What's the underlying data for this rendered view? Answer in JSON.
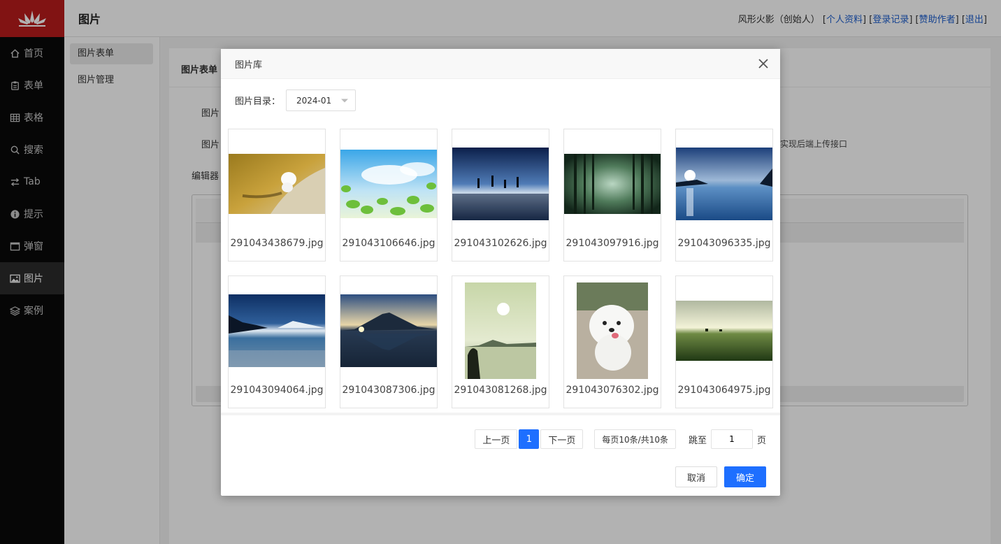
{
  "sidebar": {
    "items": [
      {
        "label": "首页",
        "icon": "home-icon"
      },
      {
        "label": "表单",
        "icon": "clipboard-icon"
      },
      {
        "label": "表格",
        "icon": "grid-icon"
      },
      {
        "label": "搜索",
        "icon": "search-icon"
      },
      {
        "label": "Tab",
        "icon": "swap-icon"
      },
      {
        "label": "提示",
        "icon": "info-icon"
      },
      {
        "label": "弹窗",
        "icon": "window-icon"
      },
      {
        "label": "图片",
        "icon": "image-icon",
        "active": true
      },
      {
        "label": "案例",
        "icon": "layers-icon"
      }
    ]
  },
  "header": {
    "title": "图片",
    "user": "风形火影（创始人）",
    "links": [
      "个人资料",
      "登录记录",
      "赞助作者",
      "退出"
    ]
  },
  "subnav": {
    "items": [
      "图片表单",
      "图片管理"
    ]
  },
  "page": {
    "heading": "图片表单",
    "labels": [
      "图片",
      "图片",
      "编辑器"
    ],
    "note": "实现后端上传接口"
  },
  "modal": {
    "title": "图片库",
    "dir_label": "图片目录：",
    "dir_value": "2024-01",
    "images": [
      "291043438679.jpg",
      "291043106646.jpg",
      "291043102626.jpg",
      "291043097916.jpg",
      "291043096335.jpg",
      "291043094064.jpg",
      "291043087306.jpg",
      "291043081268.jpg",
      "291043076302.jpg",
      "291043064975.jpg"
    ],
    "pager": {
      "prev": "上一页",
      "current": "1",
      "next": "下一页",
      "size_info": "每页10条/共10条",
      "jump_label": "跳至",
      "jump_value": "1",
      "jump_unit": "页"
    },
    "cancel": "取消",
    "ok": "确定"
  },
  "colors": {
    "accent": "#1e6fff",
    "logo": "#b91c1c",
    "sidebar": "#0a0a0a"
  }
}
